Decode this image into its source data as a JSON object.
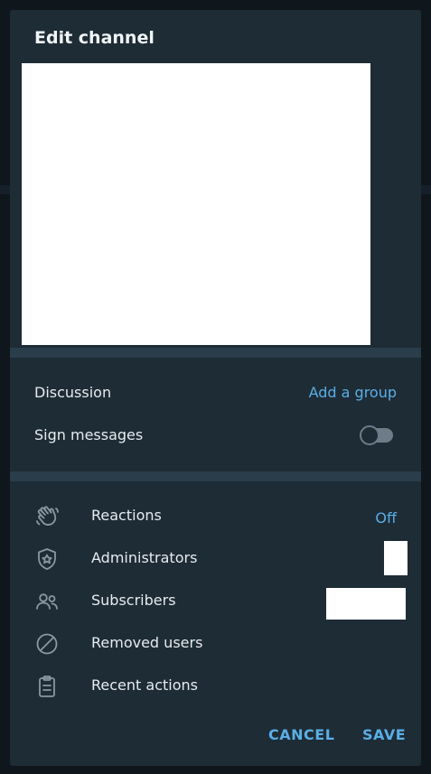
{
  "dialog": {
    "title": "Edit channel"
  },
  "settings": {
    "discussion_label": "Discussion",
    "discussion_action": "Add a group",
    "sign_messages_label": "Sign messages",
    "sign_messages_enabled": false
  },
  "menu": {
    "items": [
      {
        "label": "Reactions",
        "icon": "reactions-hand-icon",
        "value": "Off"
      },
      {
        "label": "Administrators",
        "icon": "admin-shield-icon",
        "value": ""
      },
      {
        "label": "Subscribers",
        "icon": "users-icon",
        "value": ""
      },
      {
        "label": "Removed users",
        "icon": "block-icon",
        "value": ""
      },
      {
        "label": "Recent actions",
        "icon": "clipboard-icon",
        "value": ""
      }
    ]
  },
  "footer": {
    "cancel_label": "CANCEL",
    "save_label": "SAVE"
  },
  "colors": {
    "dialog_bg": "#1e2c36",
    "separator": "#2a3d4a",
    "accent": "#5aaee6",
    "text": "#e6ebef",
    "icon": "#8a98a3"
  }
}
